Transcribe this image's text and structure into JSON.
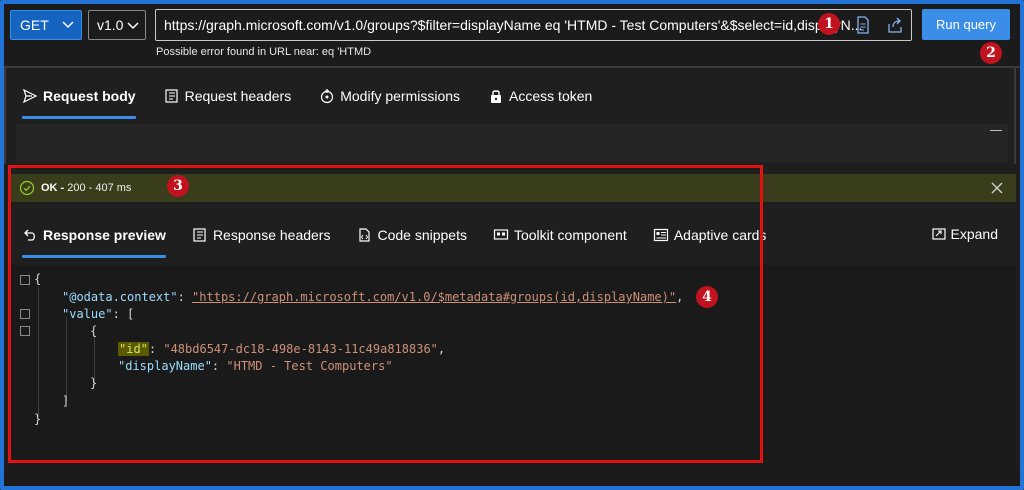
{
  "toolbar": {
    "method": "GET",
    "version": "v1.0",
    "url": "https://graph.microsoft.com/v1.0/groups?$filter=displayName eq 'HTMD - Test Computers'&$select=id,displayN...",
    "url_hint": "Possible error found in URL near: eq 'HTMD",
    "run_label": "Run query"
  },
  "request_tabs": [
    {
      "label": "Request body",
      "icon": "send-icon"
    },
    {
      "label": "Request headers",
      "icon": "headers-icon"
    },
    {
      "label": "Modify permissions",
      "icon": "permissions-icon"
    },
    {
      "label": "Access token",
      "icon": "lock-icon"
    }
  ],
  "status": {
    "ok": "OK -",
    "detail": "200 - 407 ms"
  },
  "response_tabs": [
    {
      "label": "Response preview",
      "icon": "undo-arrow-icon"
    },
    {
      "label": "Response headers",
      "icon": "headers-icon"
    },
    {
      "label": "Code snippets",
      "icon": "code-snippet-icon"
    },
    {
      "label": "Toolkit component",
      "icon": "toolkit-icon"
    },
    {
      "label": "Adaptive cards",
      "icon": "card-icon"
    }
  ],
  "expand_label": "Expand",
  "code": {
    "open_brace": "{",
    "context_key": "\"@odata.context\"",
    "context_val": "\"https://graph.microsoft.com/v1.0/$metadata#groups(id,displayName)\"",
    "value_key": "\"value\"",
    "open_bracket": "[",
    "inner_open": "{",
    "id_key": "\"id\"",
    "id_val": "\"48bd6547-dc18-498e-8143-11c49a818836\"",
    "name_key": "\"displayName\"",
    "name_val": "\"HTMD - Test Computers\"",
    "inner_close": "}",
    "close_bracket": "]",
    "close_brace": "}"
  },
  "annotations": [
    "1",
    "2",
    "3",
    "4"
  ],
  "colors": {
    "accent": "#3b8ee8",
    "annotation": "#e21212",
    "status_bg": "#393d1b"
  }
}
